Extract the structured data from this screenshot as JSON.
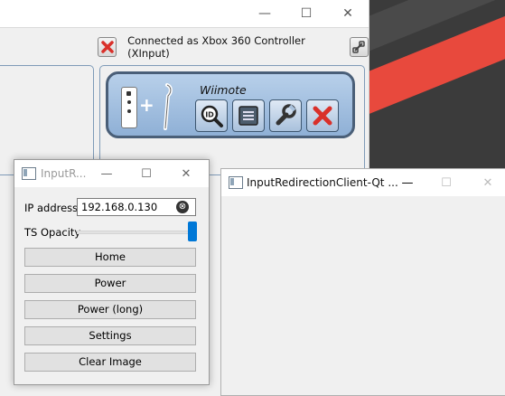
{
  "main_window": {
    "controls": {
      "minimize": "—",
      "maximize": "☐",
      "close": "✕"
    },
    "status": {
      "text": "Connected as Xbox 360 Controller (XInput)"
    },
    "wiimote": {
      "title": "Wiimote"
    }
  },
  "client_small": {
    "title": "InputR...",
    "controls": {
      "minimize": "—",
      "maximize": "☐",
      "close": "✕"
    },
    "ip_label": "IP address",
    "ip_value": "192.168.0.130",
    "clear_icon": "⊗",
    "ts_label": "TS Opacity",
    "ts_opacity_fraction": 1.0,
    "buttons": [
      "Home",
      "Power",
      "Power (long)",
      "Settings",
      "Clear Image"
    ]
  },
  "client_big": {
    "title": "InputRedirectionClient-Qt ...",
    "controls": {
      "minimize": "—",
      "maximize": "☐",
      "close": "✕"
    }
  },
  "colors": {
    "accent": "#0078d7",
    "danger": "#d9302a",
    "wiimote_bg": "#a7c2e2"
  }
}
